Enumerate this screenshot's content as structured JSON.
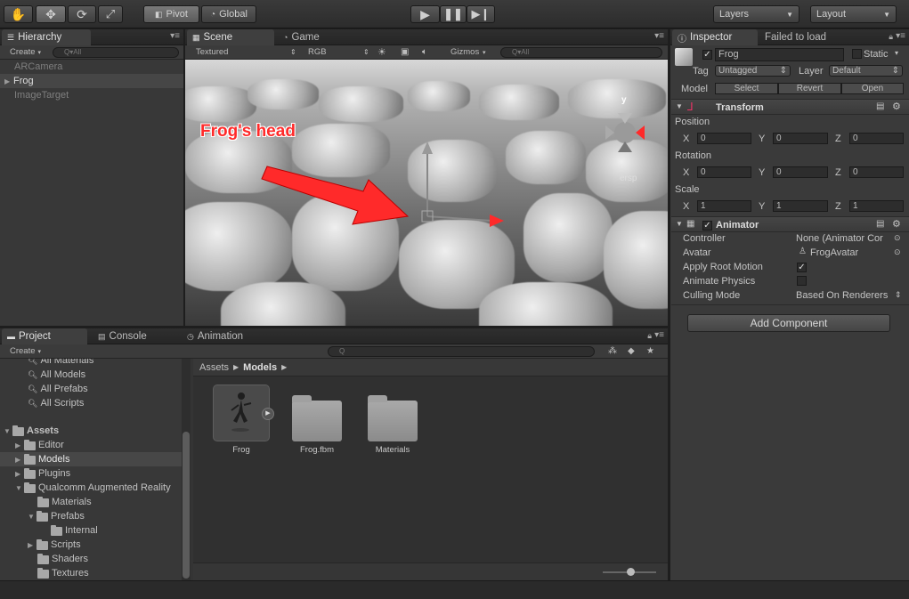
{
  "toolbar": {
    "pivot_label": "Pivot",
    "global_label": "Global",
    "layers_label": "Layers",
    "layout_label": "Layout"
  },
  "hierarchy": {
    "tab_label": "Hierarchy",
    "create_label": "Create",
    "search_placeholder": "Q▾All",
    "items": [
      "ARCamera",
      "Frog",
      "ImageTarget"
    ]
  },
  "scene": {
    "scene_tab": "Scene",
    "game_tab": "Game",
    "textured": "Textured",
    "rgb": "RGB",
    "gizmos": "Gizmos",
    "search_placeholder": "Q▾All",
    "annotation": "Frog's head",
    "axis_y": "y",
    "persp": "ersp"
  },
  "project": {
    "tabs": [
      "Project",
      "Console",
      "Animation"
    ],
    "create_label": "Create",
    "favorites": [
      "All Materials",
      "All Models",
      "All Prefabs",
      "All Scripts"
    ],
    "assets_root": "Assets",
    "tree": [
      "Editor",
      "Models",
      "Plugins",
      "Qualcomm Augmented Reality",
      "Materials",
      "Prefabs",
      "Internal",
      "Scripts",
      "Shaders",
      "Textures"
    ],
    "breadcrumb_root": "Assets",
    "breadcrumb_current": "Models",
    "assets": [
      "Frog",
      "Frog.fbm",
      "Materials"
    ]
  },
  "inspector": {
    "tab_label": "Inspector",
    "failed_tab": "Failed to load",
    "object_name": "Frog",
    "static_label": "Static",
    "tag_label": "Tag",
    "tag_value": "Untagged",
    "layer_label": "Layer",
    "layer_value": "Default",
    "model_label": "Model",
    "model_buttons": [
      "Select",
      "Revert",
      "Open"
    ],
    "transform": {
      "title": "Transform",
      "position_label": "Position",
      "rotation_label": "Rotation",
      "scale_label": "Scale",
      "position": [
        "0",
        "0",
        "0"
      ],
      "rotation": [
        "0",
        "0",
        "0"
      ],
      "scale": [
        "1",
        "1",
        "1"
      ],
      "axes": [
        "X",
        "Y",
        "Z"
      ]
    },
    "animator": {
      "title": "Animator",
      "controller_label": "Controller",
      "controller_value": "None (Animator Cor",
      "avatar_label": "Avatar",
      "avatar_value": "FrogAvatar",
      "root_motion_label": "Apply Root Motion",
      "physics_label": "Animate Physics",
      "culling_label": "Culling Mode",
      "culling_value": "Based On Renderers"
    },
    "add_component": "Add Component"
  },
  "colors": {
    "annotation_red": "#ff2a2a",
    "panel_bg": "#383838",
    "viewport_bg": "#8a8a8a"
  }
}
